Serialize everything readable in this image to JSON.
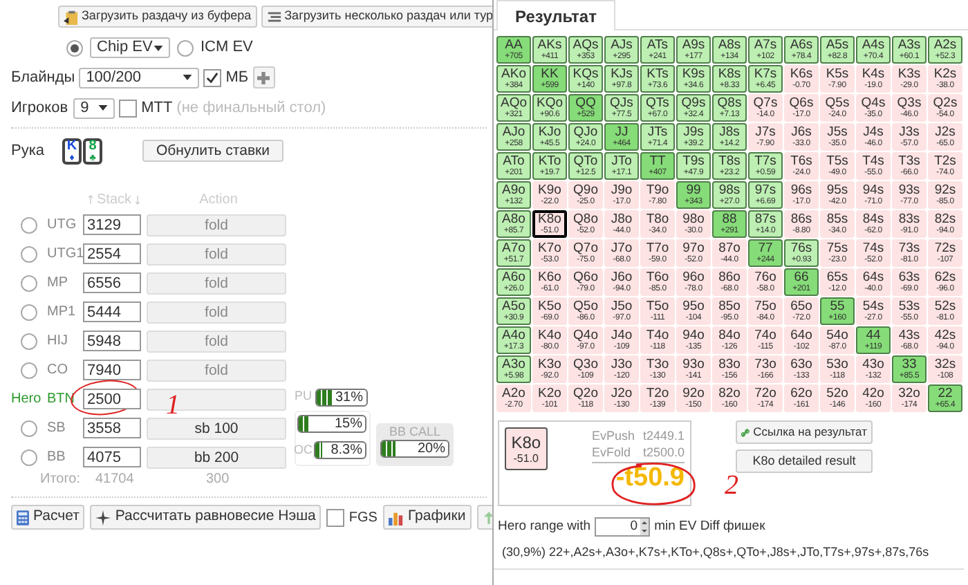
{
  "load_buttons": [
    "Загрузить раздачу из буфера",
    "Загрузить несколько раздач или тур"
  ],
  "modes": [
    {
      "selected": true,
      "select_value": "Chip EV"
    },
    {
      "selected": false,
      "label": "ICM EV"
    }
  ],
  "blinds": {
    "label": "Блайнды",
    "value": "100/200",
    "mb_label": "МБ",
    "mb_checked": true
  },
  "players": {
    "label": "Игроков",
    "value": "9",
    "mtt_label": "MTT",
    "mtt_checked": false,
    "note": "(не финальный стол)"
  },
  "hand": {
    "label": "Рука",
    "cards": [
      {
        "rank": "K",
        "suit": "♦",
        "color": "#1d4ed8"
      },
      {
        "rank": "8",
        "suit": "♣",
        "color": "#16a34a"
      }
    ],
    "reset_button": "Обнулить ставки"
  },
  "table_header": {
    "stack": "Stack",
    "action": "Action"
  },
  "seats": [
    {
      "position": "UTG",
      "stack": "3129",
      "action": "fold",
      "hero": false,
      "selected": false
    },
    {
      "position": "UTG1",
      "stack": "2554",
      "action": "fold",
      "hero": false,
      "selected": false
    },
    {
      "position": "MP",
      "stack": "6556",
      "action": "fold",
      "hero": false,
      "selected": false
    },
    {
      "position": "MP1",
      "stack": "5444",
      "action": "fold",
      "hero": false,
      "selected": false
    },
    {
      "position": "HIJ",
      "stack": "5948",
      "action": "fold",
      "hero": false,
      "selected": false
    },
    {
      "position": "CO",
      "stack": "7940",
      "action": "fold",
      "hero": false,
      "selected": false
    },
    {
      "position": "BTN",
      "stack": "2500",
      "hero": true,
      "hero_label": "Hero"
    },
    {
      "position": "SB",
      "stack": "3558",
      "action": "sb 100",
      "hero": false,
      "selected": false
    },
    {
      "position": "BB",
      "stack": "4075",
      "action": "bb 200",
      "hero": false,
      "selected": false
    }
  ],
  "pu_meter": {
    "label": "PU",
    "reading": "31%",
    "level": 0.31
  },
  "oc_meters": [
    {
      "reading": "15%",
      "level": 0.15
    },
    {
      "label": "OC",
      "reading": "8.3%",
      "level": 0.083
    }
  ],
  "bb_call": {
    "title": "BB CALL",
    "reading": "20%",
    "level": 0.2
  },
  "totals": {
    "label": "Итого:",
    "stack": "41704",
    "pot": "300"
  },
  "actions": {
    "calc": "Расчет",
    "nash": "Рассчитать равновесие Нэша",
    "fgs_label": "FGS",
    "fgs_checked": false,
    "charts": "Графики"
  },
  "result_tab": {
    "label": "Результат",
    "selected": true
  },
  "grid": [
    [
      {
        "hand": "AA",
        "ev": "+705",
        "in_range": true,
        "selected": false
      },
      {
        "hand": "AKs",
        "ev": "+411",
        "in_range": true,
        "selected": false
      },
      {
        "hand": "AQs",
        "ev": "+353",
        "in_range": true,
        "selected": false
      },
      {
        "hand": "AJs",
        "ev": "+295",
        "in_range": true,
        "selected": false
      },
      {
        "hand": "ATs",
        "ev": "+241",
        "in_range": true,
        "selected": false
      },
      {
        "hand": "A9s",
        "ev": "+177",
        "in_range": true,
        "selected": false
      },
      {
        "hand": "A8s",
        "ev": "+134",
        "in_range": true,
        "selected": false
      },
      {
        "hand": "A7s",
        "ev": "+102",
        "in_range": true,
        "selected": false
      },
      {
        "hand": "A6s",
        "ev": "+78.4",
        "in_range": true,
        "selected": false
      },
      {
        "hand": "A5s",
        "ev": "+82.8",
        "in_range": true,
        "selected": false
      },
      {
        "hand": "A4s",
        "ev": "+70.4",
        "in_range": true,
        "selected": false
      },
      {
        "hand": "A3s",
        "ev": "+60.1",
        "in_range": true,
        "selected": false
      },
      {
        "hand": "A2s",
        "ev": "+52.3",
        "in_range": true,
        "selected": false
      }
    ],
    [
      {
        "hand": "AKo",
        "ev": "+384",
        "in_range": true,
        "selected": false
      },
      {
        "hand": "KK",
        "ev": "+599",
        "in_range": true,
        "selected": false
      },
      {
        "hand": "KQs",
        "ev": "+140",
        "in_range": true,
        "selected": false
      },
      {
        "hand": "KJs",
        "ev": "+97.8",
        "in_range": true,
        "selected": false
      },
      {
        "hand": "KTs",
        "ev": "+73.6",
        "in_range": true,
        "selected": false
      },
      {
        "hand": "K9s",
        "ev": "+34.6",
        "in_range": true,
        "selected": false
      },
      {
        "hand": "K8s",
        "ev": "+8.33",
        "in_range": true,
        "selected": false
      },
      {
        "hand": "K7s",
        "ev": "+6.45",
        "in_range": true,
        "selected": false
      },
      {
        "hand": "K6s",
        "ev": "-0.70",
        "in_range": false,
        "selected": false
      },
      {
        "hand": "K5s",
        "ev": "-7.90",
        "in_range": false,
        "selected": false
      },
      {
        "hand": "K4s",
        "ev": "-19.0",
        "in_range": false,
        "selected": false
      },
      {
        "hand": "K3s",
        "ev": "-29.0",
        "in_range": false,
        "selected": false
      },
      {
        "hand": "K2s",
        "ev": "-38.0",
        "in_range": false,
        "selected": false
      }
    ],
    [
      {
        "hand": "AQo",
        "ev": "+321",
        "in_range": true,
        "selected": false
      },
      {
        "hand": "KQo",
        "ev": "+90.6",
        "in_range": true,
        "selected": false
      },
      {
        "hand": "QQ",
        "ev": "+529",
        "in_range": true,
        "selected": false
      },
      {
        "hand": "QJs",
        "ev": "+77.5",
        "in_range": true,
        "selected": false
      },
      {
        "hand": "QTs",
        "ev": "+67.0",
        "in_range": true,
        "selected": false
      },
      {
        "hand": "Q9s",
        "ev": "+32.4",
        "in_range": true,
        "selected": false
      },
      {
        "hand": "Q8s",
        "ev": "+7.13",
        "in_range": true,
        "selected": false
      },
      {
        "hand": "Q7s",
        "ev": "-14.0",
        "in_range": false,
        "selected": false
      },
      {
        "hand": "Q6s",
        "ev": "-17.0",
        "in_range": false,
        "selected": false
      },
      {
        "hand": "Q5s",
        "ev": "-24.0",
        "in_range": false,
        "selected": false
      },
      {
        "hand": "Q4s",
        "ev": "-35.0",
        "in_range": false,
        "selected": false
      },
      {
        "hand": "Q3s",
        "ev": "-46.0",
        "in_range": false,
        "selected": false
      },
      {
        "hand": "Q2s",
        "ev": "-54.0",
        "in_range": false,
        "selected": false
      }
    ],
    [
      {
        "hand": "AJo",
        "ev": "+258",
        "in_range": true,
        "selected": false
      },
      {
        "hand": "KJo",
        "ev": "+45.5",
        "in_range": true,
        "selected": false
      },
      {
        "hand": "QJo",
        "ev": "+24.0",
        "in_range": true,
        "selected": false
      },
      {
        "hand": "JJ",
        "ev": "+464",
        "in_range": true,
        "selected": false
      },
      {
        "hand": "JTs",
        "ev": "+71.4",
        "in_range": true,
        "selected": false
      },
      {
        "hand": "J9s",
        "ev": "+39.2",
        "in_range": true,
        "selected": false
      },
      {
        "hand": "J8s",
        "ev": "+14.2",
        "in_range": true,
        "selected": false
      },
      {
        "hand": "J7s",
        "ev": "-7.90",
        "in_range": false,
        "selected": false
      },
      {
        "hand": "J6s",
        "ev": "-33.0",
        "in_range": false,
        "selected": false
      },
      {
        "hand": "J5s",
        "ev": "-35.0",
        "in_range": false,
        "selected": false
      },
      {
        "hand": "J4s",
        "ev": "-46.0",
        "in_range": false,
        "selected": false
      },
      {
        "hand": "J3s",
        "ev": "-57.0",
        "in_range": false,
        "selected": false
      },
      {
        "hand": "J2s",
        "ev": "-65.0",
        "in_range": false,
        "selected": false
      }
    ],
    [
      {
        "hand": "ATo",
        "ev": "+201",
        "in_range": true,
        "selected": false
      },
      {
        "hand": "KTo",
        "ev": "+19.7",
        "in_range": true,
        "selected": false
      },
      {
        "hand": "QTo",
        "ev": "+12.5",
        "in_range": true,
        "selected": false
      },
      {
        "hand": "JTo",
        "ev": "+17.1",
        "in_range": true,
        "selected": false
      },
      {
        "hand": "TT",
        "ev": "+407",
        "in_range": true,
        "selected": false
      },
      {
        "hand": "T9s",
        "ev": "+47.9",
        "in_range": true,
        "selected": false
      },
      {
        "hand": "T8s",
        "ev": "+23.2",
        "in_range": true,
        "selected": false
      },
      {
        "hand": "T7s",
        "ev": "+0.59",
        "in_range": true,
        "selected": false
      },
      {
        "hand": "T6s",
        "ev": "-24.0",
        "in_range": false,
        "selected": false
      },
      {
        "hand": "T5s",
        "ev": "-49.0",
        "in_range": false,
        "selected": false
      },
      {
        "hand": "T4s",
        "ev": "-55.0",
        "in_range": false,
        "selected": false
      },
      {
        "hand": "T3s",
        "ev": "-66.0",
        "in_range": false,
        "selected": false
      },
      {
        "hand": "T2s",
        "ev": "-74.0",
        "in_range": false,
        "selected": false
      }
    ],
    [
      {
        "hand": "A9o",
        "ev": "+132",
        "in_range": true,
        "selected": false
      },
      {
        "hand": "K9o",
        "ev": "-22.0",
        "in_range": false,
        "selected": false
      },
      {
        "hand": "Q9o",
        "ev": "-25.0",
        "in_range": false,
        "selected": false
      },
      {
        "hand": "J9o",
        "ev": "-17.0",
        "in_range": false,
        "selected": false
      },
      {
        "hand": "T9o",
        "ev": "-7.80",
        "in_range": false,
        "selected": false
      },
      {
        "hand": "99",
        "ev": "+343",
        "in_range": true,
        "selected": false
      },
      {
        "hand": "98s",
        "ev": "+27.0",
        "in_range": true,
        "selected": false
      },
      {
        "hand": "97s",
        "ev": "+6.69",
        "in_range": true,
        "selected": false
      },
      {
        "hand": "96s",
        "ev": "-17.0",
        "in_range": false,
        "selected": false
      },
      {
        "hand": "95s",
        "ev": "-42.0",
        "in_range": false,
        "selected": false
      },
      {
        "hand": "94s",
        "ev": "-71.0",
        "in_range": false,
        "selected": false
      },
      {
        "hand": "93s",
        "ev": "-77.0",
        "in_range": false,
        "selected": false
      },
      {
        "hand": "92s",
        "ev": "-85.0",
        "in_range": false,
        "selected": false
      }
    ],
    [
      {
        "hand": "A8o",
        "ev": "+85.7",
        "in_range": true,
        "selected": false
      },
      {
        "hand": "K8o",
        "ev": "-51.0",
        "in_range": false,
        "selected": true
      },
      {
        "hand": "Q8o",
        "ev": "-52.0",
        "in_range": false,
        "selected": false
      },
      {
        "hand": "J8o",
        "ev": "-44.0",
        "in_range": false,
        "selected": false
      },
      {
        "hand": "T8o",
        "ev": "-34.0",
        "in_range": false,
        "selected": false
      },
      {
        "hand": "98o",
        "ev": "-30.0",
        "in_range": false,
        "selected": false
      },
      {
        "hand": "88",
        "ev": "+291",
        "in_range": true,
        "selected": false
      },
      {
        "hand": "87s",
        "ev": "+14.0",
        "in_range": true,
        "selected": false
      },
      {
        "hand": "86s",
        "ev": "-8.80",
        "in_range": false,
        "selected": false
      },
      {
        "hand": "85s",
        "ev": "-34.0",
        "in_range": false,
        "selected": false
      },
      {
        "hand": "84s",
        "ev": "-62.0",
        "in_range": false,
        "selected": false
      },
      {
        "hand": "83s",
        "ev": "-91.0",
        "in_range": false,
        "selected": false
      },
      {
        "hand": "82s",
        "ev": "-94.0",
        "in_range": false,
        "selected": false
      }
    ],
    [
      {
        "hand": "A7o",
        "ev": "+51.7",
        "in_range": true,
        "selected": false
      },
      {
        "hand": "K7o",
        "ev": "-53.0",
        "in_range": false,
        "selected": false
      },
      {
        "hand": "Q7o",
        "ev": "-75.0",
        "in_range": false,
        "selected": false
      },
      {
        "hand": "J7o",
        "ev": "-68.0",
        "in_range": false,
        "selected": false
      },
      {
        "hand": "T7o",
        "ev": "-59.0",
        "in_range": false,
        "selected": false
      },
      {
        "hand": "97o",
        "ev": "-52.0",
        "in_range": false,
        "selected": false
      },
      {
        "hand": "87o",
        "ev": "-44.0",
        "in_range": false,
        "selected": false
      },
      {
        "hand": "77",
        "ev": "+244",
        "in_range": true,
        "selected": false
      },
      {
        "hand": "76s",
        "ev": "+0.93",
        "in_range": true,
        "selected": false
      },
      {
        "hand": "75s",
        "ev": "-23.0",
        "in_range": false,
        "selected": false
      },
      {
        "hand": "74s",
        "ev": "-52.0",
        "in_range": false,
        "selected": false
      },
      {
        "hand": "73s",
        "ev": "-81.0",
        "in_range": false,
        "selected": false
      },
      {
        "hand": "72s",
        "ev": "-107",
        "in_range": false,
        "selected": false
      }
    ],
    [
      {
        "hand": "A6o",
        "ev": "+26.0",
        "in_range": true,
        "selected": false
      },
      {
        "hand": "K6o",
        "ev": "-61.0",
        "in_range": false,
        "selected": false
      },
      {
        "hand": "Q6o",
        "ev": "-79.0",
        "in_range": false,
        "selected": false
      },
      {
        "hand": "J6o",
        "ev": "-94.0",
        "in_range": false,
        "selected": false
      },
      {
        "hand": "T6o",
        "ev": "-85.0",
        "in_range": false,
        "selected": false
      },
      {
        "hand": "96o",
        "ev": "-78.0",
        "in_range": false,
        "selected": false
      },
      {
        "hand": "86o",
        "ev": "-68.0",
        "in_range": false,
        "selected": false
      },
      {
        "hand": "76o",
        "ev": "-58.0",
        "in_range": false,
        "selected": false
      },
      {
        "hand": "66",
        "ev": "+201",
        "in_range": true,
        "selected": false
      },
      {
        "hand": "65s",
        "ev": "-12.0",
        "in_range": false,
        "selected": false
      },
      {
        "hand": "64s",
        "ev": "-40.0",
        "in_range": false,
        "selected": false
      },
      {
        "hand": "63s",
        "ev": "-69.0",
        "in_range": false,
        "selected": false
      },
      {
        "hand": "62s",
        "ev": "-96.0",
        "in_range": false,
        "selected": false
      }
    ],
    [
      {
        "hand": "A5o",
        "ev": "+30.9",
        "in_range": true,
        "selected": false
      },
      {
        "hand": "K5o",
        "ev": "-69.0",
        "in_range": false,
        "selected": false
      },
      {
        "hand": "Q5o",
        "ev": "-86.0",
        "in_range": false,
        "selected": false
      },
      {
        "hand": "J5o",
        "ev": "-97.0",
        "in_range": false,
        "selected": false
      },
      {
        "hand": "T5o",
        "ev": "-111",
        "in_range": false,
        "selected": false
      },
      {
        "hand": "95o",
        "ev": "-104",
        "in_range": false,
        "selected": false
      },
      {
        "hand": "85o",
        "ev": "-95.0",
        "in_range": false,
        "selected": false
      },
      {
        "hand": "75o",
        "ev": "-84.0",
        "in_range": false,
        "selected": false
      },
      {
        "hand": "65o",
        "ev": "-72.0",
        "in_range": false,
        "selected": false
      },
      {
        "hand": "55",
        "ev": "+160",
        "in_range": true,
        "selected": false
      },
      {
        "hand": "54s",
        "ev": "-27.0",
        "in_range": false,
        "selected": false
      },
      {
        "hand": "53s",
        "ev": "-55.0",
        "in_range": false,
        "selected": false
      },
      {
        "hand": "52s",
        "ev": "-81.0",
        "in_range": false,
        "selected": false
      }
    ],
    [
      {
        "hand": "A4o",
        "ev": "+17.3",
        "in_range": true,
        "selected": false
      },
      {
        "hand": "K4o",
        "ev": "-80.0",
        "in_range": false,
        "selected": false
      },
      {
        "hand": "Q4o",
        "ev": "-97.0",
        "in_range": false,
        "selected": false
      },
      {
        "hand": "J4o",
        "ev": "-109",
        "in_range": false,
        "selected": false
      },
      {
        "hand": "T4o",
        "ev": "-118",
        "in_range": false,
        "selected": false
      },
      {
        "hand": "94o",
        "ev": "-135",
        "in_range": false,
        "selected": false
      },
      {
        "hand": "84o",
        "ev": "-126",
        "in_range": false,
        "selected": false
      },
      {
        "hand": "74o",
        "ev": "-115",
        "in_range": false,
        "selected": false
      },
      {
        "hand": "64o",
        "ev": "-102",
        "in_range": false,
        "selected": false
      },
      {
        "hand": "54o",
        "ev": "-87.0",
        "in_range": false,
        "selected": false
      },
      {
        "hand": "44",
        "ev": "+119",
        "in_range": true,
        "selected": false
      },
      {
        "hand": "43s",
        "ev": "-68.0",
        "in_range": false,
        "selected": false
      },
      {
        "hand": "42s",
        "ev": "-94.0",
        "in_range": false,
        "selected": false
      }
    ],
    [
      {
        "hand": "A3o",
        "ev": "+5.98",
        "in_range": true,
        "selected": false
      },
      {
        "hand": "K3o",
        "ev": "-92.0",
        "in_range": false,
        "selected": false
      },
      {
        "hand": "Q3o",
        "ev": "-109",
        "in_range": false,
        "selected": false
      },
      {
        "hand": "J3o",
        "ev": "-120",
        "in_range": false,
        "selected": false
      },
      {
        "hand": "T3o",
        "ev": "-130",
        "in_range": false,
        "selected": false
      },
      {
        "hand": "93o",
        "ev": "-141",
        "in_range": false,
        "selected": false
      },
      {
        "hand": "83o",
        "ev": "-156",
        "in_range": false,
        "selected": false
      },
      {
        "hand": "73o",
        "ev": "-166",
        "in_range": false,
        "selected": false
      },
      {
        "hand": "63o",
        "ev": "-133",
        "in_range": false,
        "selected": false
      },
      {
        "hand": "53o",
        "ev": "-118",
        "in_range": false,
        "selected": false
      },
      {
        "hand": "43o",
        "ev": "-132",
        "in_range": false,
        "selected": false
      },
      {
        "hand": "33",
        "ev": "+85.5",
        "in_range": true,
        "selected": false
      },
      {
        "hand": "32s",
        "ev": "-108",
        "in_range": false,
        "selected": false
      }
    ],
    [
      {
        "hand": "A2o",
        "ev": "-2.70",
        "in_range": false,
        "selected": false
      },
      {
        "hand": "K2o",
        "ev": "-101",
        "in_range": false,
        "selected": false
      },
      {
        "hand": "Q2o",
        "ev": "-118",
        "in_range": false,
        "selected": false
      },
      {
        "hand": "J2o",
        "ev": "-130",
        "in_range": false,
        "selected": false
      },
      {
        "hand": "T2o",
        "ev": "-139",
        "in_range": false,
        "selected": false
      },
      {
        "hand": "92o",
        "ev": "-150",
        "in_range": false,
        "selected": false
      },
      {
        "hand": "82o",
        "ev": "-160",
        "in_range": false,
        "selected": false
      },
      {
        "hand": "72o",
        "ev": "-174",
        "in_range": false,
        "selected": false
      },
      {
        "hand": "62o",
        "ev": "-161",
        "in_range": false,
        "selected": false
      },
      {
        "hand": "52o",
        "ev": "-146",
        "in_range": false,
        "selected": false
      },
      {
        "hand": "42o",
        "ev": "-160",
        "in_range": false,
        "selected": false
      },
      {
        "hand": "32o",
        "ev": "-174",
        "in_range": false,
        "selected": false
      },
      {
        "hand": "22",
        "ev": "+65.4",
        "in_range": true,
        "selected": false
      }
    ]
  ],
  "result": {
    "hand": "K8o",
    "ev": "-51.0",
    "push_label": "EvPush",
    "push_value": "t2449.1",
    "fold_label": "EvFold",
    "fold_value": "t2500.0",
    "diff": "-t50.9"
  },
  "link_button": "Ссылка на результат",
  "detail_button": "K8o detailed result",
  "range_filter": {
    "prefix": "Hero range with",
    "value": "0",
    "suffix": "min EV Diff фишек"
  },
  "range_text": "(30,9%) 22+,A2s+,A3o+,K7s+,KTo+,Q8s+,QTo+,J8s+,JTo,T7s+,97s+,87s,76s",
  "annotations": [
    {
      "text": "1"
    },
    {
      "text": "2"
    }
  ]
}
